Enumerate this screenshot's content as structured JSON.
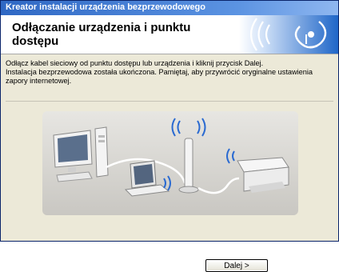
{
  "window": {
    "title": "Kreator instalacji urządzenia bezprzewodowego"
  },
  "header": {
    "title": "Odłączanie urządzenia i punktu dostępu"
  },
  "instructions": {
    "line1": "Odłącz kabel sieciowy od punktu dostępu lub urządzenia i kliknij przycisk Dalej.",
    "line2": "Instalacja bezprzewodowa została ukończona. Pamiętaj, aby przywrócić oryginalne ustawienia zapory internetowej."
  },
  "buttons": {
    "next_label": "Dalej >"
  },
  "colors": {
    "titlebar_start": "#2f68c4",
    "titlebar_end": "#8fb7f0",
    "banner_blue": "#1f66c8",
    "window_bg": "#ece9d8"
  },
  "icons": [
    "wireless-logo-icon",
    "wifi-signal-icon"
  ]
}
